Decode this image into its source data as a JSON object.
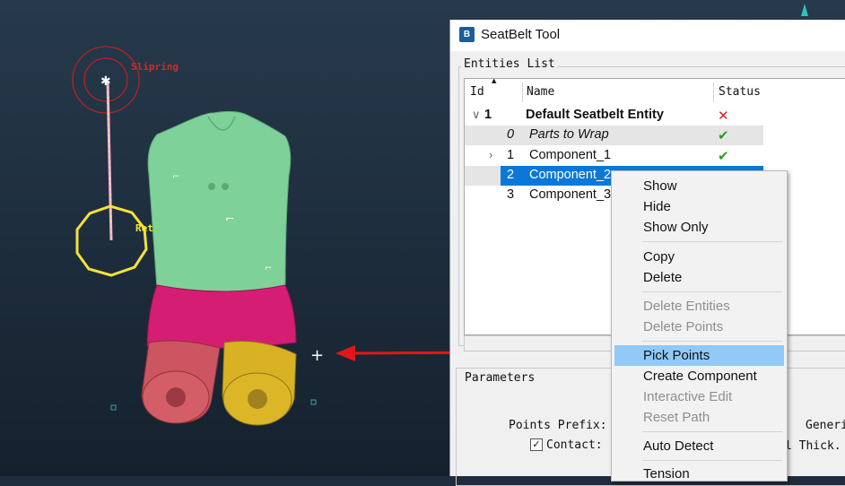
{
  "viewport": {
    "labels": {
      "slipring": "Slipring",
      "retractor": "Ret"
    },
    "colors": {
      "background": "#1d2d3d",
      "torso": "#7fd19a",
      "pelvis": "#d51d74",
      "leg_left": "#cc5561",
      "leg_right": "#d9b224",
      "slipring": "#d02a2a",
      "retractor": "#f4e23a",
      "arrow": "#e0171a"
    }
  },
  "window": {
    "title": "SeatBelt Tool",
    "icon": "app-logo-icon",
    "entities_group_title": "Entities List",
    "columns": {
      "id": "Id",
      "name": "Name",
      "status": "Status"
    },
    "rows": [
      {
        "id": "1",
        "name": "Default Seatbelt Entity",
        "status": "error"
      },
      {
        "id": "0",
        "name": "Parts to Wrap",
        "status": "ok"
      },
      {
        "id": "1",
        "name": "Component_1",
        "status": "ok"
      },
      {
        "id": "2",
        "name": "Component_2",
        "status": ""
      },
      {
        "id": "3",
        "name": "Component_3",
        "status": ""
      }
    ],
    "status_icons": {
      "error": "✕",
      "ok": "✔"
    },
    "params_group_title": "Parameters",
    "params": {
      "points_prefix_label": "Points Prefix:",
      "contact_label": "Contact:",
      "contact_checked": true,
      "generic_label": "Generi",
      "thick_label": "l Thick."
    }
  },
  "context_menu": {
    "items": [
      {
        "label": "Show",
        "enabled": true
      },
      {
        "label": "Hide",
        "enabled": true
      },
      {
        "label": "Show Only",
        "enabled": true
      },
      {
        "label": "Copy",
        "enabled": true
      },
      {
        "label": "Delete",
        "enabled": true
      },
      {
        "label": "Delete Entities",
        "enabled": false
      },
      {
        "label": "Delete Points",
        "enabled": false
      },
      {
        "label": "Pick Points",
        "enabled": true,
        "highlighted": true
      },
      {
        "label": "Create Component",
        "enabled": true
      },
      {
        "label": "Interactive Edit",
        "enabled": false
      },
      {
        "label": "Reset Path",
        "enabled": false
      },
      {
        "label": "Auto Detect",
        "enabled": true
      },
      {
        "label": "Tension",
        "enabled": true
      }
    ]
  }
}
